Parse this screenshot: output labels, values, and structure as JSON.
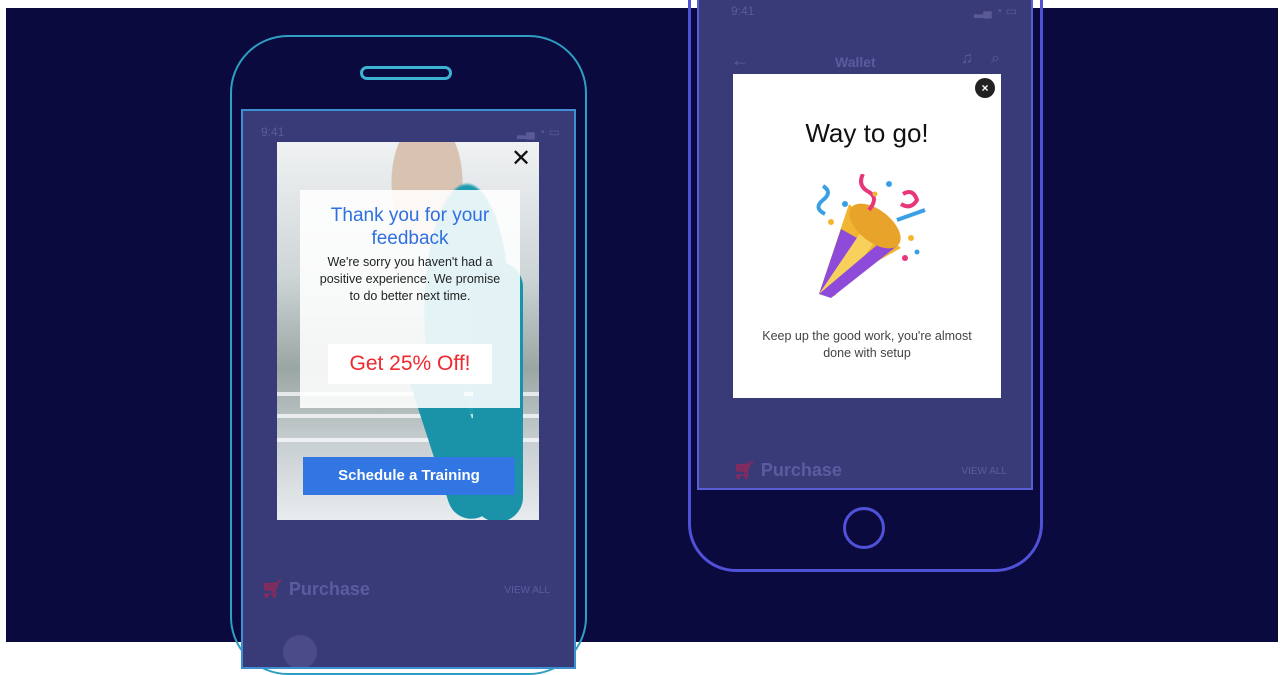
{
  "phone1": {
    "status_time": "9:41",
    "purchase_label": "Purchase",
    "view_all_label": "VIEW ALL"
  },
  "popup1": {
    "title": "Thank you for your feedback",
    "message": "We're sorry you haven't had a positive experience. We promise to do better next time.",
    "offer": "Get 25% Off!",
    "cta": "Schedule a Training",
    "close_glyph": "✕"
  },
  "phone2": {
    "status_time": "9:41",
    "header_title": "Wallet",
    "purchase_label": "Purchase",
    "view_all_label": "VIEW ALL"
  },
  "popup2": {
    "title": "Way to go!",
    "message": "Keep up the good work, you're almost done with setup",
    "close_glyph": "×",
    "illustration": "party-popper-icon"
  },
  "colors": {
    "background": "#0b0a3f",
    "phone_outline_left": "#2e9fc0",
    "phone_outline_right": "#4f52d8",
    "accent_blue": "#3176e3",
    "offer_red": "#f0292f"
  }
}
